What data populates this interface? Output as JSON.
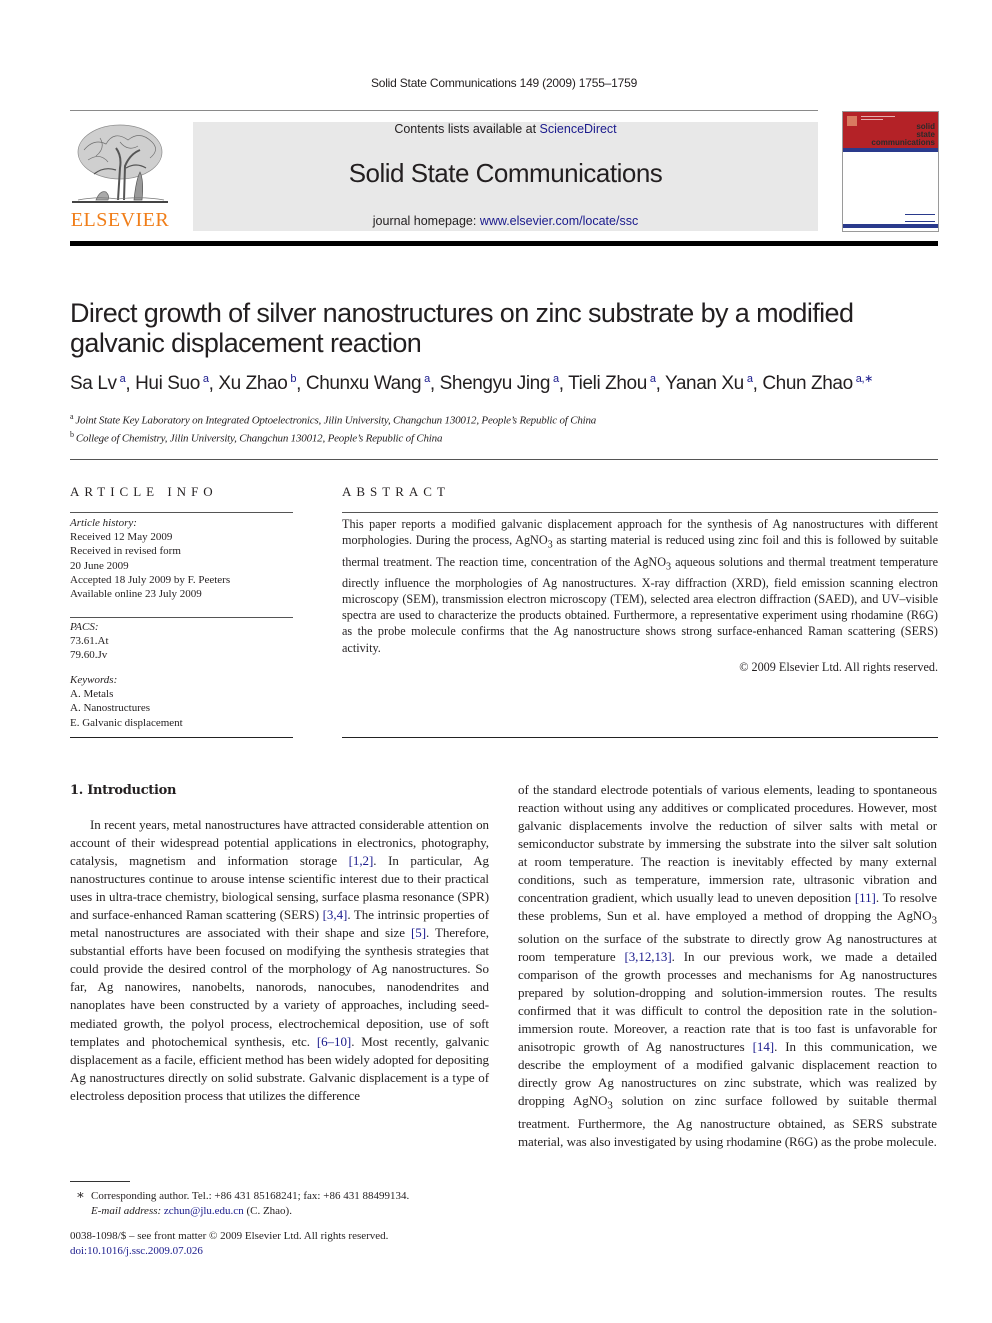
{
  "header": {
    "running_head": "Solid State Communications 149 (2009) 1755–1759",
    "publisher_logo_text": "ELSEVIER",
    "contents_prefix": "Contents lists available at ",
    "contents_link": "ScienceDirect",
    "journal_title": "Solid State Communications",
    "homepage_prefix": "journal homepage: ",
    "homepage_link": "www.elsevier.com/locate/ssc",
    "cover_title_lines": [
      "solid",
      "state",
      "communications"
    ],
    "colors": {
      "elsevier_orange": "#f07e19",
      "cover_red": "#b42227",
      "link_blue": "#1a1a8c",
      "banner_gray": "#e8e8e8"
    }
  },
  "article": {
    "title": "Direct growth of silver nanostructures on zinc substrate by a modified galvanic displacement reaction",
    "authors": [
      {
        "name": "Sa Lv",
        "aff": "a"
      },
      {
        "name": "Hui Suo",
        "aff": "a"
      },
      {
        "name": "Xu Zhao",
        "aff": "b"
      },
      {
        "name": "Chunxu Wang",
        "aff": "a"
      },
      {
        "name": "Shengyu Jing",
        "aff": "a"
      },
      {
        "name": "Tieli Zhou",
        "aff": "a"
      },
      {
        "name": "Yanan Xu",
        "aff": "a"
      },
      {
        "name": "Chun Zhao",
        "aff": "a,∗"
      }
    ],
    "affiliations": [
      {
        "mark": "a",
        "text": "Joint State Key Laboratory on Integrated Optoelectronics, Jilin University, Changchun 130012, People’s Republic of China"
      },
      {
        "mark": "b",
        "text": "College of Chemistry, Jilin University, Changchun 130012, People’s Republic of China"
      }
    ]
  },
  "article_info": {
    "heading": "ARTICLE INFO",
    "history_label": "Article history:",
    "history": [
      "Received 12 May 2009",
      "Received in revised form",
      "20 June 2009",
      "Accepted 18 July 2009 by F. Peeters",
      "Available online 23 July 2009"
    ],
    "pacs_label": "PACS:",
    "pacs": [
      "73.61.At",
      "79.60.Jv"
    ],
    "keywords_label": "Keywords:",
    "keywords": [
      "A. Metals",
      "A. Nanostructures",
      "E. Galvanic displacement"
    ]
  },
  "abstract": {
    "heading": "ABSTRACT",
    "p1": "This paper reports a modified galvanic displacement approach for the synthesis of Ag nanostructures with different morphologies. During the process, AgNO",
    "p2": " as starting material is reduced using zinc foil and this is followed by suitable thermal treatment. The reaction time, concentration of the AgNO",
    "p3": " aqueous solutions and thermal treatment temperature directly influence the morphologies of Ag nanostructures. X-ray diffraction (XRD), field emission scanning electron microscopy (SEM), transmission electron microscopy (TEM), selected area electron diffraction (SAED), and UV–visible spectra are used to characterize the products obtained. Furthermore, a representative experiment using rhodamine (R6G) as the probe molecule confirms that the Ag nanostructure shows strong surface-enhanced Raman scattering (SERS) activity.",
    "sub3": "3",
    "copyright": "© 2009 Elsevier Ltd. All rights reserved."
  },
  "body": {
    "section_heading": "1.  Introduction",
    "left": {
      "s1": "In recent years, metal nanostructures have attracted considerable attention on account of their widespread potential applications in electronics, photography, catalysis, magnetism and information storage ",
      "c1": "[1,2]",
      "s2": ". In particular, Ag nanostructures continue to arouse intense scientific interest due to their practical uses in ultra-trace chemistry, biological sensing, surface plasma resonance (SPR) and surface-enhanced Raman scattering (SERS) ",
      "c2": "[3,4]",
      "s3": ". The intrinsic properties of metal nanostructures are associated with their shape and size ",
      "c3": "[5]",
      "s4": ". Therefore, substantial efforts have been focused on modifying the synthesis strategies that could provide the desired control of the morphology of Ag nanostructures. So far, Ag nanowires, nanobelts, nanorods, nanocubes, nanodendrites and nanoplates have been constructed by a variety of approaches, including seed-mediated growth, the polyol process, electrochemical deposition, use of soft templates and photochemical synthesis, etc. ",
      "c4": "[6–10]",
      "s5": ". Most recently, galvanic displacement as a facile, efficient method has been widely adopted for depositing Ag nanostructures directly on solid substrate. Galvanic displacement is a type of electroless deposition process that utilizes the difference"
    },
    "right": {
      "s1": "of the standard electrode potentials of various elements, leading to spontaneous reaction without using any additives or complicated procedures. However, most galvanic displacements involve the reduction of silver salts with metal or semiconductor substrate by immersing the substrate into the silver salt solution at room temperature. The reaction is inevitably effected by many external conditions, such as temperature, immersion rate, ultrasonic vibration and concentration gradient, which usually lead to uneven deposition ",
      "c1": "[11]",
      "s2": ". To resolve these problems, Sun et al. have employed a method of dropping the AgNO",
      "s3": " solution on the surface of the substrate to directly grow Ag nanostructures at room temperature ",
      "c2": "[3,12,13]",
      "s4": ". In our previous work, we made a detailed comparison of the growth processes and mechanisms for Ag nanostructures prepared by solution-dropping and solution-immersion routes. The results confirmed that it was difficult to control the deposition rate in the solution-immersion route. Moreover, a reaction rate that is too fast is unfavorable for anisotropic growth of Ag nanostructures ",
      "c3": "[14]",
      "s5": ". In this communication, we describe the employment of a modified galvanic displacement reaction to directly grow Ag nanostructures on zinc substrate, which was realized by dropping AgNO",
      "s6": " solution on zinc surface followed by suitable thermal treatment. Furthermore, the Ag nanostructure obtained, as SERS substrate material, was also investigated by using rhodamine (R6G) as the probe molecule.",
      "sub3": "3"
    }
  },
  "footnote": {
    "star": "∗",
    "text": "Corresponding author. Tel.: +86 431 85168241; fax: +86 431 88499134.",
    "email_label": "E-mail address: ",
    "email": "zchun@jlu.edu.cn",
    "email_suffix": " (C. Zhao)."
  },
  "footer": {
    "issn_line": "0038-1098/$ – see front matter © 2009 Elsevier Ltd. All rights reserved.",
    "doi": "doi:10.1016/j.ssc.2009.07.026"
  }
}
